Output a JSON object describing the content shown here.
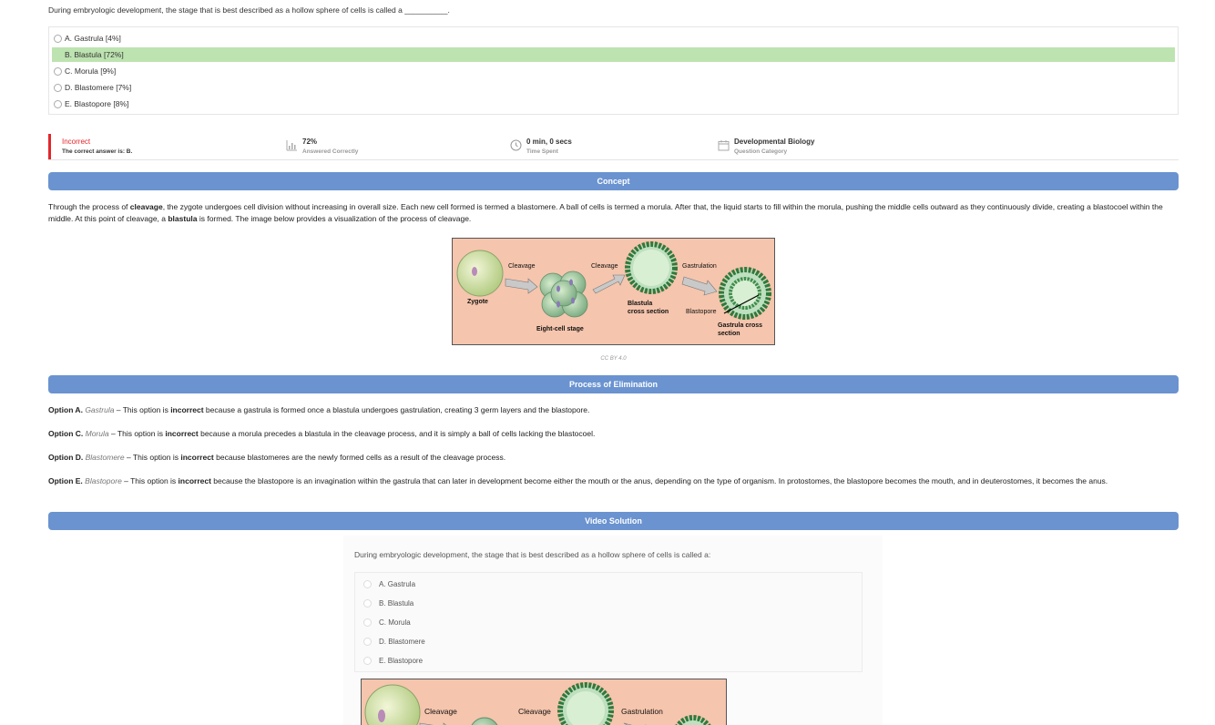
{
  "question": "During embryologic development, the stage that is best described as a hollow sphere of cells is called a __________.",
  "choices": [
    {
      "label": "A. Gastrula [4%]",
      "correct": false
    },
    {
      "label": "B. Blastula [72%]",
      "correct": true
    },
    {
      "label": "C. Morula [9%]",
      "correct": false
    },
    {
      "label": "D. Blastomere [7%]",
      "correct": false
    },
    {
      "label": "E. Blastopore [8%]",
      "correct": false
    }
  ],
  "stats": {
    "result": "Incorrect",
    "answer": "The correct answer is: B.",
    "percent": "72%",
    "percent_label": "Answered Correctly",
    "time": "0 min, 0 secs",
    "time_label": "Time Spent",
    "category": "Developmental Biology",
    "category_label": "Question Category"
  },
  "concept": {
    "heading": "Concept",
    "p1_a": "Through the process of ",
    "p1_b": "cleavage",
    "p1_c": ", the zygote undergoes cell division without increasing in overall size. Each new cell formed is termed a blastomere. A ball of cells is termed a morula. After that, the liquid starts to fill within the morula, pushing the middle cells outward as they continuously divide, creating a blastocoel within the middle. At this point of cleavage, a ",
    "p1_d": "blastula",
    "p1_e": " is formed. The image below provides a visualization of the process of cleavage.",
    "caption": "CC BY 4.0"
  },
  "diagram": {
    "zygote": "Zygote",
    "cleavage1": "Cleavage",
    "cleavage2": "Cleavage",
    "gastrulation": "Gastrulation",
    "eight_cell": "Eight-cell stage",
    "blastula_1": "Blastula",
    "blastula_2": "cross section",
    "blastopore": "Blastopore",
    "gastrula_1": "Gastrula cross",
    "gastrula_2": "section"
  },
  "elimination": {
    "heading": "Process of Elimination",
    "a_opt": "Option A.",
    "a_name": "Gastrula",
    "a_pre": " – This option is ",
    "a_bold": "incorrect",
    "a_rest": " because a gastrula is formed once a blastula undergoes gastrulation, creating 3 germ layers and the blastopore.",
    "c_opt": "Option C.",
    "c_name": "Morula",
    "c_pre": " – This option is ",
    "c_bold": "incorrect",
    "c_rest": " because a morula precedes a blastula in the cleavage process, and it is simply a ball of cells lacking the blastocoel.",
    "d_opt": "Option D.",
    "d_name": "Blastomere",
    "d_pre": " – This option is ",
    "d_bold": "incorrect",
    "d_rest": " because blastomeres are the newly formed cells as a result of the cleavage process.",
    "e_opt": "Option E.",
    "e_name": "Blastopore",
    "e_pre": " – This option is ",
    "e_bold": "incorrect",
    "e_rest": " because the blastopore is an invagination within the gastrula that can later in development become either the mouth or the anus, depending on the type of organism. In protostomes, the blastopore becomes the mouth, and in deuterostomes, it becomes the anus."
  },
  "video": {
    "heading": "Video Solution",
    "question": "During embryologic development, the stage that is best described as a hollow sphere of cells is called a:",
    "choices": [
      "A. Gastrula",
      "B. Blastula",
      "C. Morula",
      "D. Blastomere",
      "E. Blastopore"
    ],
    "cleavage1": "Cleavage",
    "cleavage2": "Cleavage",
    "gastrulation": "Gastrulation"
  },
  "colors": {
    "accent": "#6a93d0",
    "correct_bg": "#bde3b0",
    "incorrect": "#e3262b"
  }
}
